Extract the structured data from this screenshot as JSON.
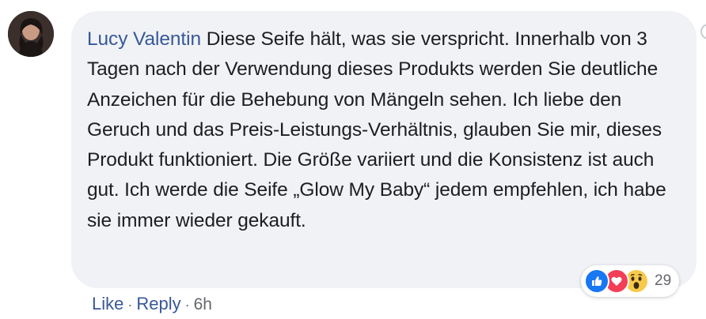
{
  "comment": {
    "author": "Lucy Valentin",
    "text": "Diese Seife hält, was sie verspricht. Innerhalb von 3 Tagen nach der Verwendung dieses Produkts werden Sie deutliche Anzeichen für die Behebung von Mängeln sehen. Ich liebe den Geruch und das Preis-Leistungs-Verhältnis, glauben Sie mir, dieses Produkt funktioniert. Die Größe variiert und die Konsistenz ist auch gut. Ich werde die Seife „Glow My Baby“ jedem empfehlen, ich habe sie immer wieder gekauft."
  },
  "reactions": {
    "types": [
      "like-icon",
      "love-icon",
      "wow-icon"
    ],
    "count": "29"
  },
  "actions": {
    "like_label": "Like",
    "separator": "·",
    "reply_label": "Reply",
    "time": "6h"
  },
  "colors": {
    "link": "#385898",
    "bubble_bg": "#f0f2f5",
    "text": "#1c1e21",
    "meta": "#65676b",
    "like": "#1877f2",
    "love": "#f33e58",
    "wow": "#f7c94b"
  }
}
